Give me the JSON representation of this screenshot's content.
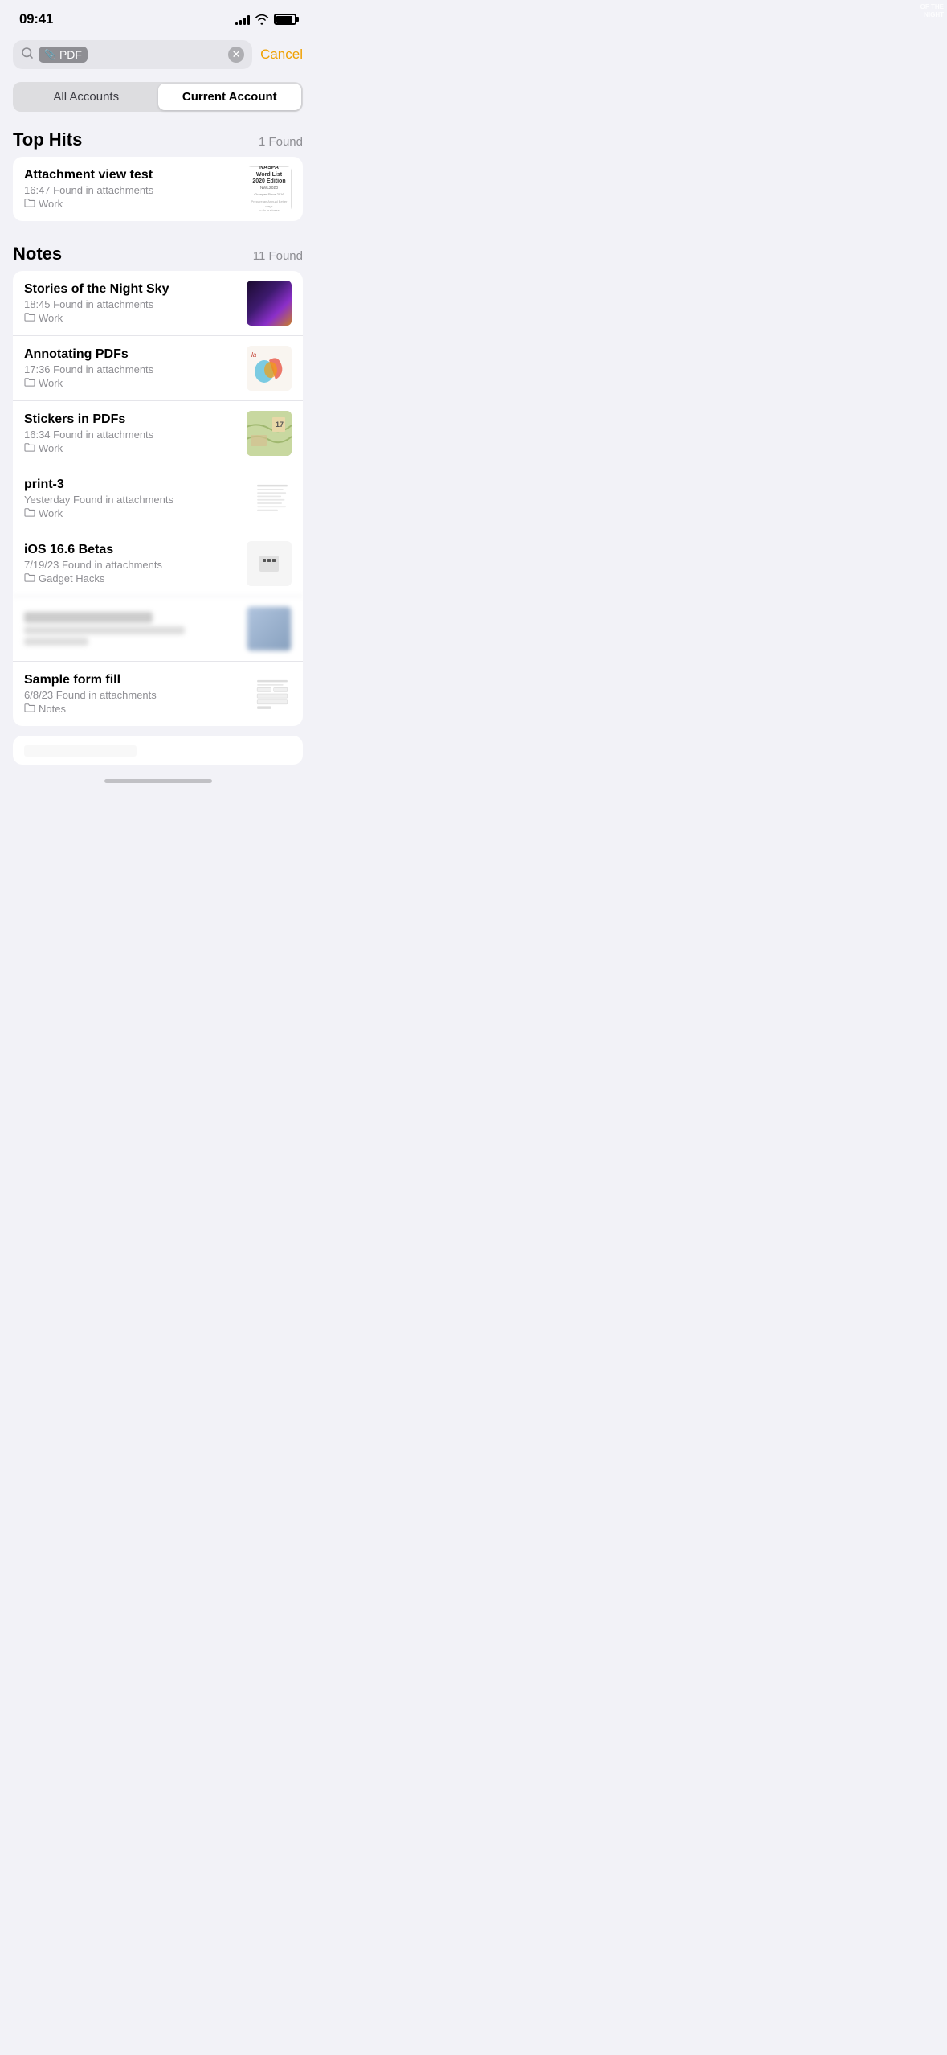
{
  "statusBar": {
    "time": "09:41",
    "signalBars": [
      3,
      5,
      8,
      11,
      14
    ],
    "batteryPercent": 90
  },
  "searchBar": {
    "tagIcon": "📎",
    "tagLabel": "PDF",
    "cancelLabel": "Cancel",
    "clearAriaLabel": "clear search"
  },
  "segmentControl": {
    "options": [
      "All Accounts",
      "Current Account"
    ],
    "activeIndex": 1
  },
  "topHits": {
    "sectionTitle": "Top Hits",
    "count": "1 Found",
    "items": [
      {
        "title": "Attachment view test",
        "meta": "16:47  Found in attachments",
        "folder": "Work",
        "thumbType": "word-list"
      }
    ]
  },
  "notes": {
    "sectionTitle": "Notes",
    "count": "11 Found",
    "items": [
      {
        "title": "Stories of the Night Sky",
        "meta": "18:45  Found in attachments",
        "folder": "Work",
        "thumbType": "night-sky",
        "blurred": false
      },
      {
        "title": "Annotating PDFs",
        "meta": "17:36  Found in attachments",
        "folder": "Work",
        "thumbType": "pdf-colorful",
        "blurred": false
      },
      {
        "title": "Stickers in PDFs",
        "meta": "16:34  Found in attachments",
        "folder": "Work",
        "thumbType": "map",
        "blurred": false
      },
      {
        "title": "print-3",
        "meta": "Yesterday  Found in attachments",
        "folder": "Work",
        "thumbType": "print",
        "blurred": false
      },
      {
        "title": "iOS 16.6 Betas",
        "meta": "7/19/23  Found in attachments",
        "folder": "Gadget Hacks",
        "thumbType": "ios",
        "blurred": false
      },
      {
        "title": "",
        "meta": "",
        "folder": "",
        "thumbType": "blurred",
        "blurred": true
      },
      {
        "title": "Sample form fill",
        "meta": "6/8/23  Found in attachments",
        "folder": "Notes",
        "thumbType": "form",
        "blurred": false
      }
    ]
  }
}
